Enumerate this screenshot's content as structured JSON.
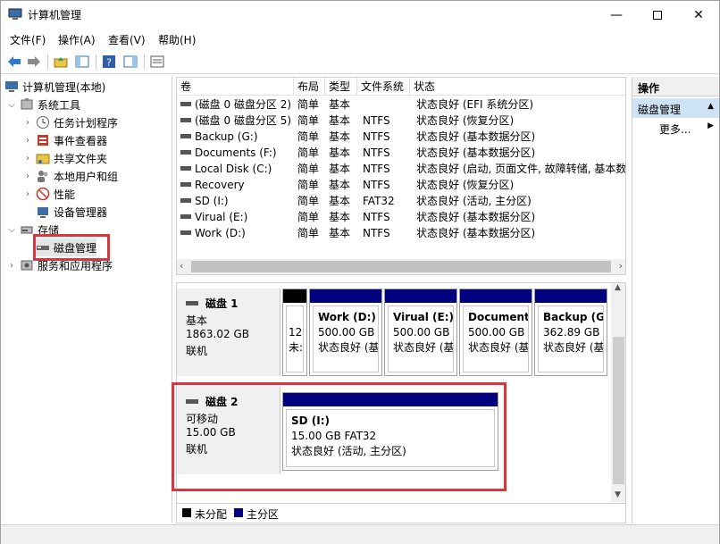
{
  "window": {
    "title": "计算机管理"
  },
  "menu": [
    "文件(F)",
    "操作(A)",
    "查看(V)",
    "帮助(H)"
  ],
  "tree": {
    "root": "计算机管理(本地)",
    "system_tools": "系统工具",
    "task_scheduler": "任务计划程序",
    "event_viewer": "事件查看器",
    "shared_folders": "共享文件夹",
    "local_users": "本地用户和组",
    "performance": "性能",
    "device_manager": "设备管理器",
    "storage": "存储",
    "disk_management": "磁盘管理",
    "services": "服务和应用程序"
  },
  "volume_list": {
    "headers": [
      "卷",
      "布局",
      "类型",
      "文件系统",
      "状态"
    ],
    "rows": [
      [
        "(磁盘 0 磁盘分区 2)",
        "简单",
        "基本",
        "",
        "状态良好 (EFI 系统分区)"
      ],
      [
        "(磁盘 0 磁盘分区 5)",
        "简单",
        "基本",
        "NTFS",
        "状态良好 (恢复分区)"
      ],
      [
        "Backup (G:)",
        "简单",
        "基本",
        "NTFS",
        "状态良好 (基本数据分区)"
      ],
      [
        "Documents (F:)",
        "简单",
        "基本",
        "NTFS",
        "状态良好 (基本数据分区)"
      ],
      [
        "Local Disk (C:)",
        "简单",
        "基本",
        "NTFS",
        "状态良好 (启动, 页面文件, 故障转储, 基本数"
      ],
      [
        "Recovery",
        "简单",
        "基本",
        "NTFS",
        "状态良好 (恢复分区)"
      ],
      [
        "SD (I:)",
        "简单",
        "基本",
        "FAT32",
        "状态良好 (活动, 主分区)"
      ],
      [
        "Virual (E:)",
        "简单",
        "基本",
        "NTFS",
        "状态良好 (基本数据分区)"
      ],
      [
        "Work (D:)",
        "简单",
        "基本",
        "NTFS",
        "状态良好 (基本数据分区)"
      ]
    ]
  },
  "disk1": {
    "name": "磁盘 1",
    "type": "基本",
    "size": "1863.02 GB",
    "status": "联机",
    "stub_line1": "12",
    "stub_line2": "未:",
    "partitions": [
      {
        "name": "Work  (D:)",
        "size": "500.00 GB N",
        "status": "状态良好 (基"
      },
      {
        "name": "Virual  (E:)",
        "size": "500.00 GB N",
        "status": "状态良好 (基"
      },
      {
        "name": "Documents",
        "size": "500.00 GB N",
        "status": "状态良好 (基"
      },
      {
        "name": "Backup  (G:",
        "size": "362.89 GB N",
        "status": "状态良好 (基"
      }
    ]
  },
  "disk2": {
    "name": "磁盘 2",
    "type": "可移动",
    "size": "15.00 GB",
    "status": "联机",
    "partition": {
      "name": "SD  (I:)",
      "size": "15.00 GB FAT32",
      "status": "状态良好 (活动, 主分区)"
    }
  },
  "legend": {
    "unallocated": "未分配",
    "primary": "主分区"
  },
  "actions": {
    "header": "操作",
    "section": "磁盘管理",
    "more": "更多..."
  },
  "colors": {
    "primary_partition": "#00007f",
    "unallocated": "#000000",
    "highlight": "#d9363e",
    "selected_section": "#cfe3f7"
  }
}
